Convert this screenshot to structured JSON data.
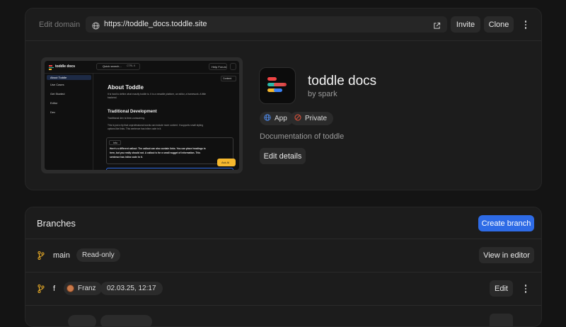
{
  "header": {
    "edit_domain_label": "Edit domain",
    "url": "https://toddle_docs.toddle.site",
    "invite_label": "Invite",
    "clone_label": "Clone"
  },
  "preview": {
    "brand": "toddle docs",
    "search_placeholder": "Quick search...",
    "search_shortcut": "CTRL K",
    "help_label": "Help Forum",
    "nav": [
      "About Toddle",
      "Use Cases",
      "Get Started",
      "Editor",
      "Dev"
    ],
    "content_label": "Content",
    "heading": "About Toddle",
    "intro": "It is hard to define what exactly toddle is. It is a versatile platform, an editor, a framework. A little backend.",
    "subheading": "Traditional Development",
    "sub_text": "Traditional dev is time-consuming.",
    "para_line1": "This is just a tip that unprofessional words can include more content. It supports small styling",
    "para_line2": "options like links. This sentence has inline code in it.",
    "callout_tag": "Info",
    "callout_line1": "Here's a different callout. The callout can also contain links. You can place headings in",
    "callout_line2": "here, but you really should not. A callout is for a small nugget of information. This",
    "callout_line3": "sentence has inline code in it.",
    "ask_ai_label": "Ask AI"
  },
  "project": {
    "name": "toddle docs",
    "author": "by spark",
    "type_label": "App",
    "visibility_label": "Private",
    "description": "Documentation of toddle",
    "edit_details_label": "Edit details"
  },
  "branches": {
    "title": "Branches",
    "create_label": "Create branch",
    "rows": [
      {
        "name": "main",
        "badge": "Read-only",
        "action": "View in editor"
      },
      {
        "name": "f",
        "user": "Franz",
        "timestamp": "02.03.25, 12:17",
        "action": "Edit"
      }
    ]
  },
  "colors": {
    "accent": "#2e6be6",
    "logo_red": "#ef4444",
    "logo_yellow": "#f5b82e",
    "logo_teal": "#2bb8a8",
    "logo_blue": "#3b82f6",
    "branch_icon": "#e0a526"
  }
}
